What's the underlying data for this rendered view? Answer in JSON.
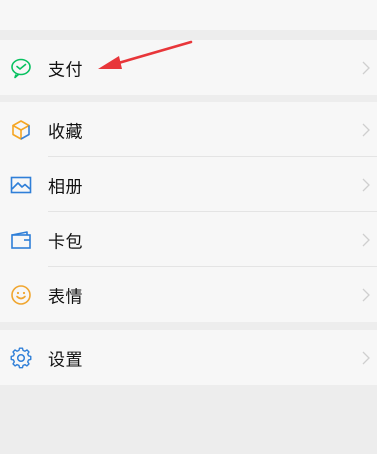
{
  "menu": {
    "pay": {
      "label": "支付",
      "icon": "wechat-pay-icon"
    },
    "favorites": {
      "label": "收藏",
      "icon": "cube-icon"
    },
    "album": {
      "label": "相册",
      "icon": "image-icon"
    },
    "cards": {
      "label": "卡包",
      "icon": "wallet-icon"
    },
    "stickers": {
      "label": "表情",
      "icon": "smiley-icon"
    },
    "settings": {
      "label": "设置",
      "icon": "gear-icon"
    }
  },
  "colors": {
    "background": "#ededed",
    "row_background": "#f7f7f7",
    "annotation_arrow": "#e8363a",
    "pay_icon": "#07c160",
    "favorites_icon_orange": "#f5a623",
    "favorites_icon_blue": "#3b82d6",
    "album_icon": "#2f7fd8",
    "cards_icon": "#2f7fd8",
    "stickers_icon": "#f0a630",
    "settings_icon": "#2f7fd8"
  }
}
